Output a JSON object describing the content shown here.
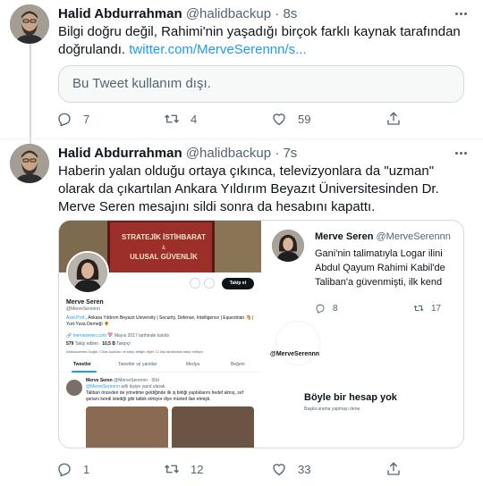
{
  "tweet1": {
    "name": "Halid Abdurrahman",
    "handle": "@halidbackup",
    "dot": "·",
    "time": "8s",
    "text": "Bilgi doğru değil, Rahimi'nin yaşadığı birçok farklı kaynak tarafından doğrulandı.",
    "link": "twitter.com/MerveSerennn/s...",
    "unavailable": "Bu Tweet kullanım dışı.",
    "reply_count": "7",
    "retweet_count": "4",
    "like_count": "59"
  },
  "tweet2": {
    "name": "Halid Abdurrahman",
    "handle": "@halidbackup",
    "dot": "·",
    "time": "7s",
    "text": "Haberin yalan olduğu ortaya çıkınca, televizyonlara da \"uzman\" olarak da çıkartılan Ankara Yıldırım Beyazıt Üniversitesinden Dr. Merve Seren mesajını sildi sonra da hesabını kapattı.",
    "reply_count": "1",
    "retweet_count": "12",
    "like_count": "33"
  },
  "profile_shot": {
    "banner_line1": "STRATEJİK İSTİHBARAT",
    "banner_amp": "&",
    "banner_line2": "ULUSAL GÜVENLİK",
    "follow_btn": "Takip et",
    "name": "Merve Seren",
    "handle": "@MerveSerennn",
    "bio_blue": "Asst.Prof.",
    "bio_rest": ", Ankara Yıldırım Beyazıt University | Security, Defense, Intelligence | Equestrian 🐴 | Yurt-Yuva Derneği 🌻",
    "site": "merveseren.com",
    "joined": "Mayıs 2017 tarihinde katıldı",
    "following_num": "579",
    "following_label": "Takip edilen",
    "followers_num": "10,5 B",
    "followers_label": "Takipçi",
    "known": "Abdussamed Dağül, Cihat Açıkcan ve takip ettiğin diğer 12 kişi tarafından takip ediliyor",
    "tabs": [
      "Tweetler",
      "Tweetler ve yanıtlar",
      "Medya",
      "Beğeni"
    ],
    "inner_name": "Merve Seren",
    "inner_handle": "@MerveSerennn · 50d",
    "inner_reply_prefix": "@MerveSerennn",
    "inner_reply_rest": " adlı kişiye yanıt olarak",
    "inner_text": "Taliban önceden de yönetime geldiğinde ilk iş birliği yaptıklarını hedef almış, sırf şerianı kendi istediği gibi tatbik etmiyor diye mürted ilan etmişti."
  },
  "tweet_shot": {
    "name": "Merve Seren",
    "handle": "@MerveSerennn",
    "line1": "Gani'nin talimatıyla Logar ilini",
    "line2": "Abdul Qayum Rahimi Kabil'de",
    "line3": "Taliban'a güvenmişti, ilk kend",
    "reply_count": "8",
    "retweet_count": "17",
    "handle2": "@MerveSerennn",
    "nf_title": "Böyle bir hesap yok",
    "nf_sub": "Başka arama yapmayı dene."
  }
}
